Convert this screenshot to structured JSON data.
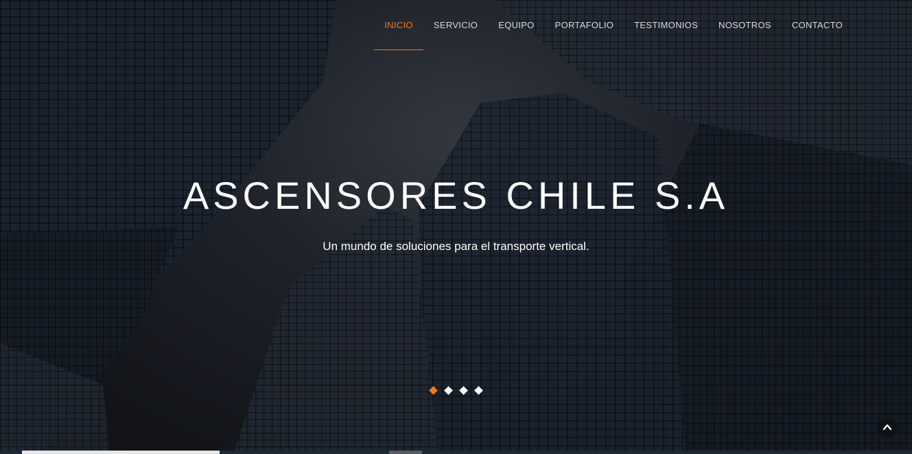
{
  "nav": {
    "items": [
      {
        "label": "INICIO",
        "active": true
      },
      {
        "label": "SERVICIO",
        "active": false
      },
      {
        "label": "EQUIPO",
        "active": false
      },
      {
        "label": "PORTAFOLIO",
        "active": false
      },
      {
        "label": "TESTIMONIOS",
        "active": false
      },
      {
        "label": "NOSOTROS",
        "active": false
      },
      {
        "label": "CONTACTO",
        "active": false
      }
    ]
  },
  "hero": {
    "title": "ASCENSORES CHILE S.A",
    "subtitle": "Un mundo de soluciones para el transporte vertical.",
    "slides_total": 4,
    "slide_active_index": 0
  },
  "colors": {
    "accent": "#f07b1d",
    "text": "#ffffff",
    "nav_text": "#d7d9dc"
  },
  "icons": {
    "back_to_top": "chevron-up-icon"
  }
}
